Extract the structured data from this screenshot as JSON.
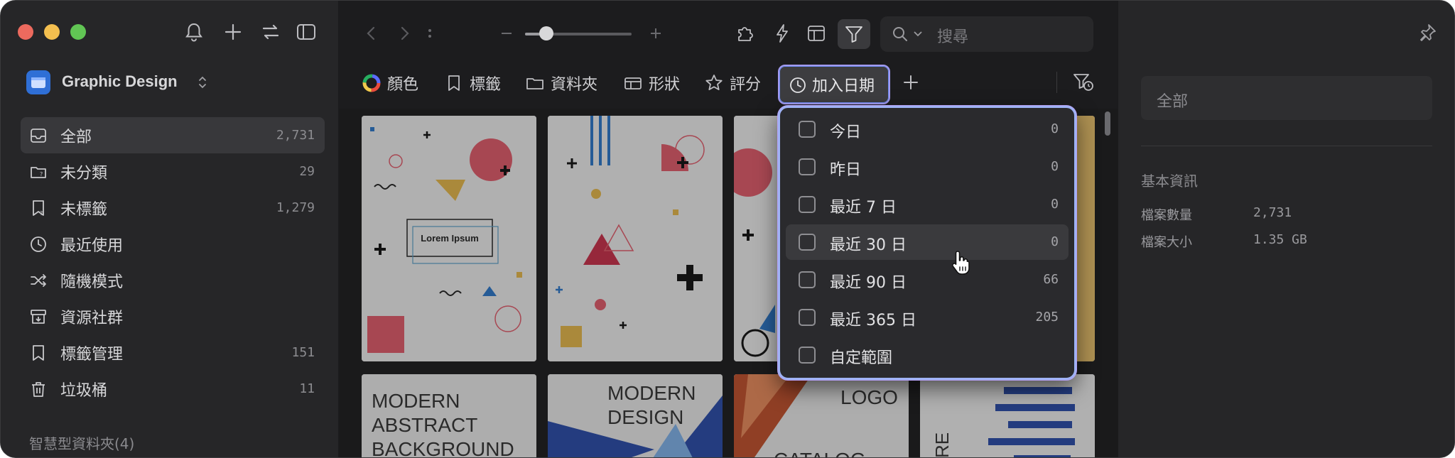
{
  "sidebar": {
    "library_name": "Graphic Design",
    "items": [
      {
        "label": "全部",
        "count": "2,731",
        "icon": "inbox-icon",
        "active": true
      },
      {
        "label": "未分類",
        "count": "29",
        "icon": "folder-question-icon"
      },
      {
        "label": "未標籤",
        "count": "1,279",
        "icon": "tag-question-icon"
      },
      {
        "label": "最近使用",
        "count": "",
        "icon": "clock-icon"
      },
      {
        "label": "隨機模式",
        "count": "",
        "icon": "shuffle-icon"
      },
      {
        "label": "資源社群",
        "count": "",
        "icon": "download-box-icon"
      },
      {
        "label": "標籤管理",
        "count": "151",
        "icon": "bookmark-icon"
      },
      {
        "label": "垃圾桶",
        "count": "11",
        "icon": "trash-icon"
      }
    ],
    "smart_folders_label": "智慧型資料夾(4)"
  },
  "toolbar": {
    "search_placeholder": "搜尋",
    "zoom_level": 0.2
  },
  "filters": {
    "color": "顏色",
    "tags": "標籤",
    "folders": "資料夾",
    "shape": "形狀",
    "rating": "評分",
    "date_added": "加入日期"
  },
  "thumbnails": {
    "card1_text": "Lorem Ipsum",
    "card5_text": [
      "MODERN",
      "ABSTRACT",
      "BACKGROUND"
    ],
    "card6_text": [
      "MODERN",
      "DESIGN"
    ],
    "card7_text": [
      "LOGO",
      "CATALOG"
    ],
    "card8_text": "RE"
  },
  "dropdown": {
    "options": [
      {
        "label": "今日",
        "count": "0"
      },
      {
        "label": "昨日",
        "count": "0"
      },
      {
        "label": "最近 7 日",
        "count": "0"
      },
      {
        "label": "最近 30 日",
        "count": "0",
        "hover": true
      },
      {
        "label": "最近 90 日",
        "count": "66"
      },
      {
        "label": "最近 365 日",
        "count": "205"
      },
      {
        "label": "自定範圍",
        "count": ""
      }
    ]
  },
  "inspector": {
    "field_value": "全部",
    "heading": "基本資訊",
    "rows": [
      {
        "key": "檔案數量",
        "value": "2,731"
      },
      {
        "key": "檔案大小",
        "value": "1.35 GB"
      }
    ]
  },
  "colors": {
    "accent_outline": "#9fb2f5",
    "library_icon": "#2f6fd6"
  }
}
